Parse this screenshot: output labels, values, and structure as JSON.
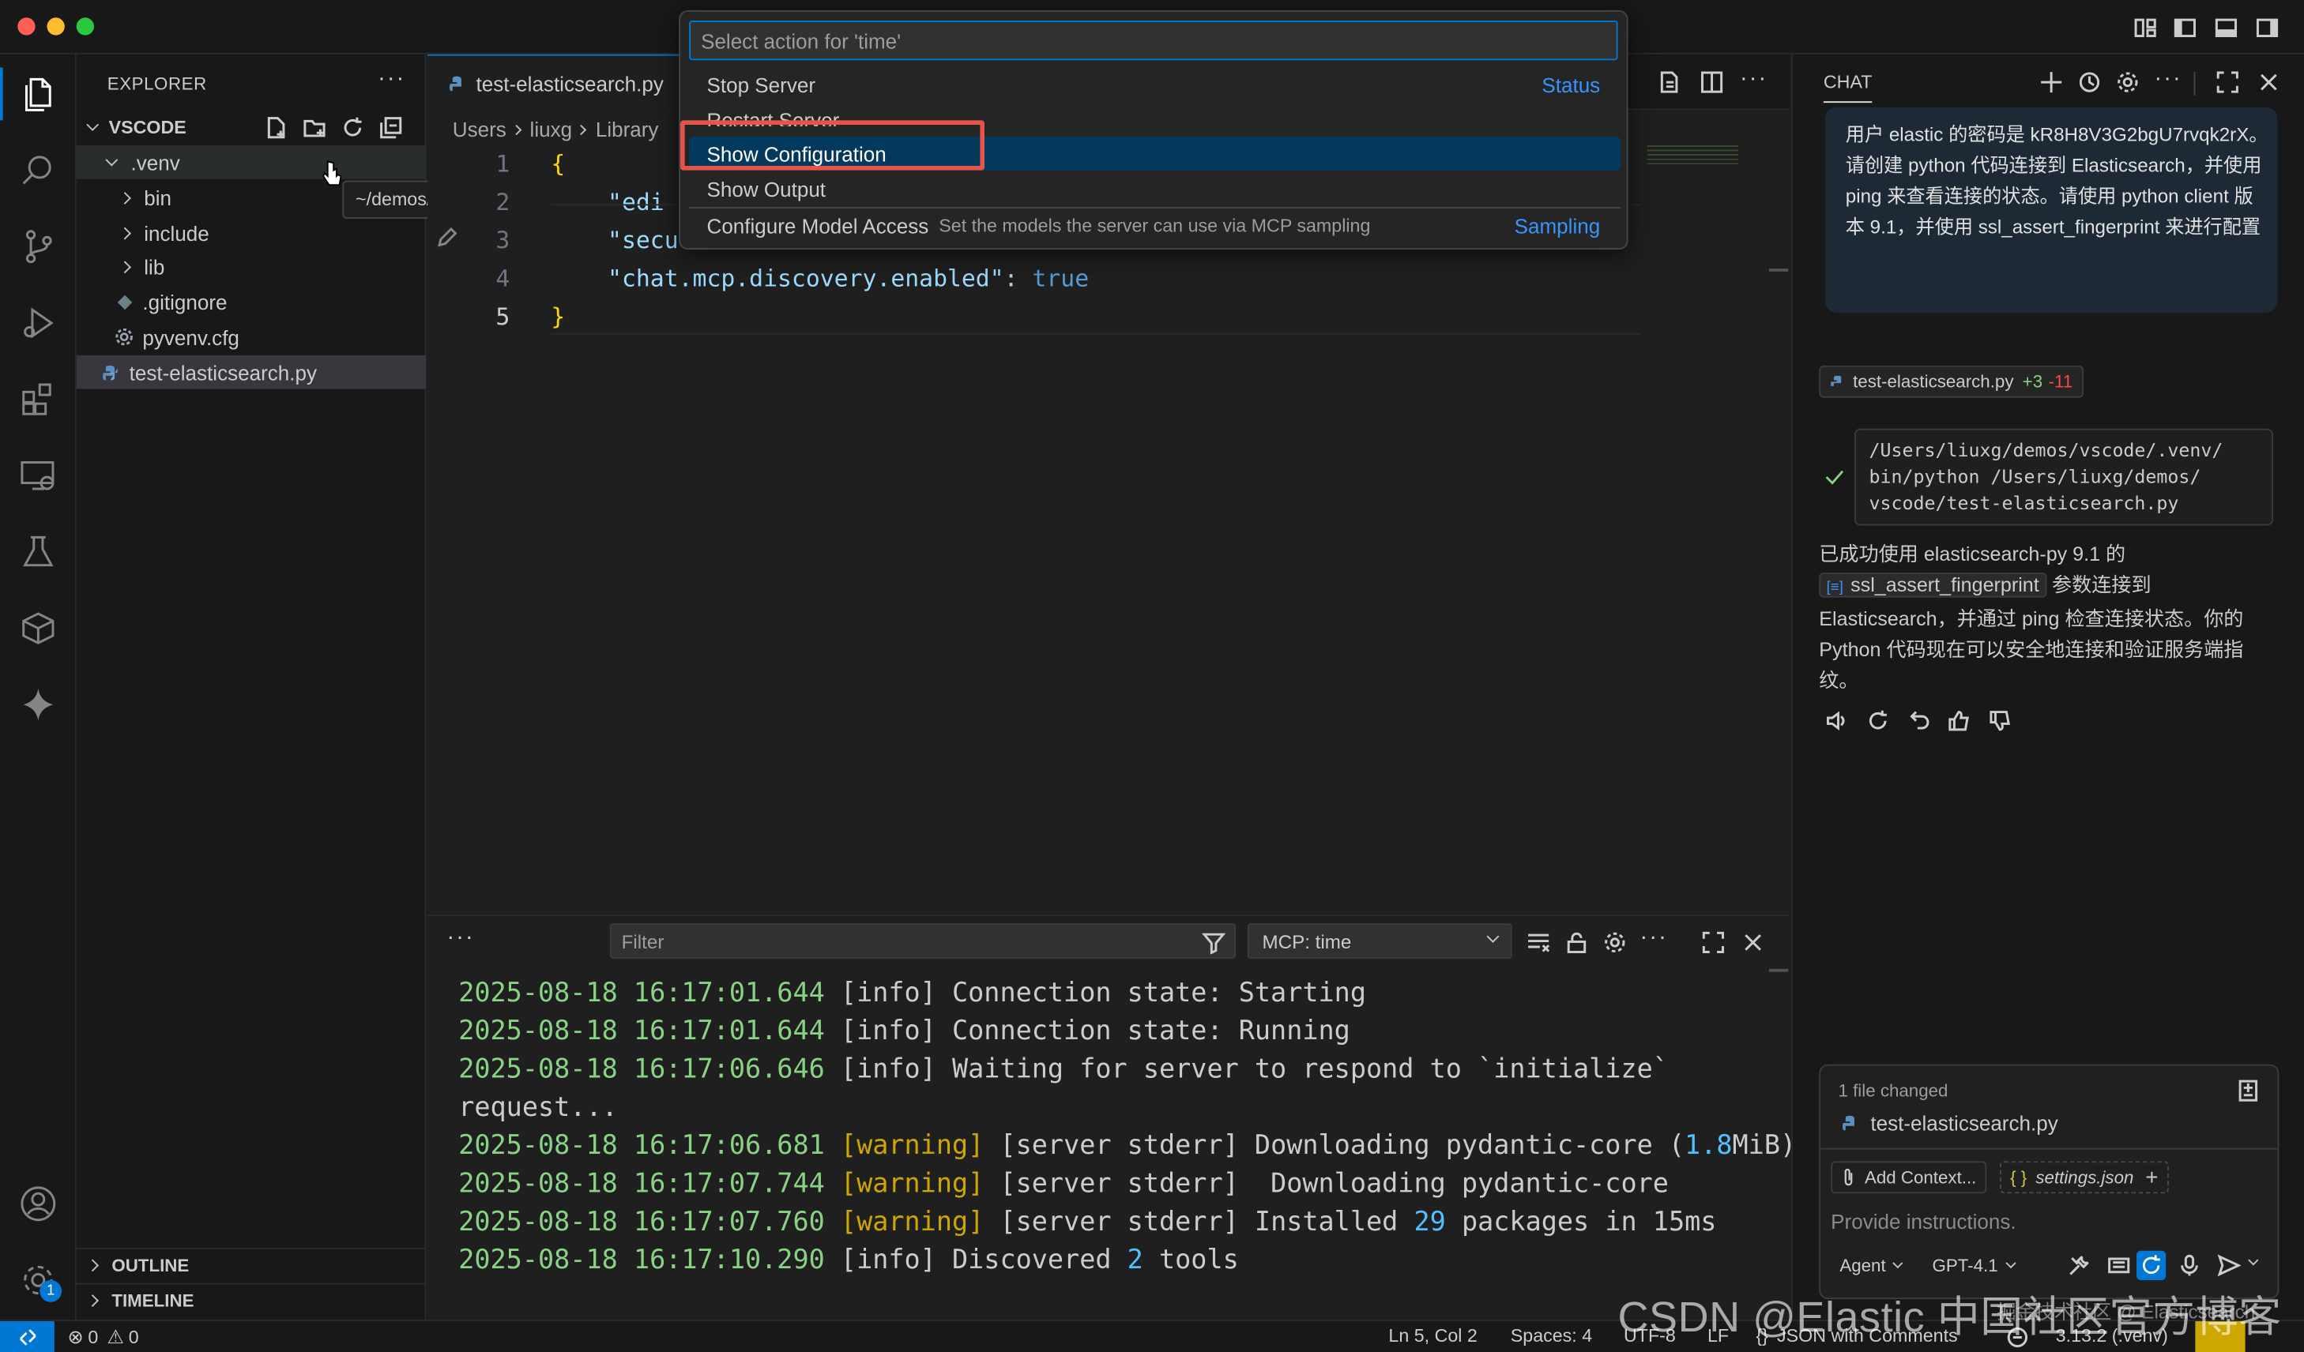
{
  "colors": {
    "accent": "#0078d4",
    "selection": "#04395e",
    "highlight_box": "#e5534b",
    "string": "#ce9178",
    "key": "#9cdcfe",
    "bool": "#569cd6",
    "brace": "#ffd700",
    "timestamp": "#89d185",
    "warning": "#cca700",
    "number": "#4fc1ff"
  },
  "explorer": {
    "title": "EXPLORER",
    "root": "VSCODE",
    "items": [
      {
        "label": ".venv",
        "kind": "folder-open"
      },
      {
        "label": "bin",
        "kind": "folder"
      },
      {
        "label": "include",
        "kind": "folder"
      },
      {
        "label": "lib",
        "kind": "folder"
      },
      {
        "label": ".gitignore",
        "kind": "git-file"
      },
      {
        "label": "pyvenv.cfg",
        "kind": "gear-file"
      },
      {
        "label": "test-elasticsearch.py",
        "kind": "python-file"
      }
    ],
    "tooltip": "~/demos/vscode/.venv",
    "outline": "OUTLINE",
    "timeline": "TIMELINE",
    "accounts_badge": "1"
  },
  "editor": {
    "tab_label": "test-elasticsearch.py",
    "breadcrumb": [
      "Users",
      "liuxg",
      "Library"
    ],
    "lines": [
      {
        "n": "1",
        "parts": [
          {
            "t": "{",
            "c": "brace"
          }
        ]
      },
      {
        "n": "2",
        "parts": [
          {
            "t": "    \"edi",
            "c": "key"
          }
        ]
      },
      {
        "n": "3",
        "parts": [
          {
            "t": "    \"secu",
            "c": "key"
          }
        ]
      },
      {
        "n": "4",
        "parts": [
          {
            "t": "    \"chat.mcp.discovery.enabled\"",
            "c": "key"
          },
          {
            "t": ": ",
            "c": "plain"
          },
          {
            "t": "true",
            "c": "bool"
          }
        ]
      },
      {
        "n": "5",
        "parts": [
          {
            "t": "}",
            "c": "brace"
          }
        ]
      }
    ]
  },
  "quick_pick": {
    "placeholder": "Select action for 'time'",
    "items": [
      {
        "label": "Stop Server",
        "desc": "",
        "right": "Status"
      },
      {
        "label": "Restart Server",
        "desc": "",
        "right": ""
      },
      {
        "label": "Show Configuration",
        "desc": "",
        "right": ""
      },
      {
        "label": "Show Output",
        "desc": "",
        "right": ""
      },
      {
        "label": "Configure Model Access",
        "desc": "Set the models the server can use via MCP sampling",
        "right": "Sampling"
      }
    ]
  },
  "panel": {
    "filter_placeholder": "Filter",
    "channel": "MCP: time",
    "logs": [
      [
        {
          "t": "2025-08-18 16:17:01.644",
          "c": "ts"
        },
        {
          "t": " [info] Connection state: Starting",
          "c": "info"
        }
      ],
      [
        {
          "t": "2025-08-18 16:17:01.644",
          "c": "ts"
        },
        {
          "t": " [info] Connection state: Running",
          "c": "info"
        }
      ],
      [
        {
          "t": "2025-08-18 16:17:06.646",
          "c": "ts"
        },
        {
          "t": " [info] Waiting for server to respond to `initialize`",
          "c": "info"
        }
      ],
      [
        {
          "t": "request...",
          "c": "info"
        }
      ],
      [
        {
          "t": "2025-08-18 16:17:06.681",
          "c": "ts"
        },
        {
          "t": " [warning]",
          "c": "warn"
        },
        {
          "t": " [server stderr] Downloading pydantic-core (",
          "c": "info"
        },
        {
          "t": "1.8",
          "c": "num"
        },
        {
          "t": "MiB)",
          "c": "info"
        }
      ],
      [
        {
          "t": "2025-08-18 16:17:07.744",
          "c": "ts"
        },
        {
          "t": " [warning]",
          "c": "warn"
        },
        {
          "t": " [server stderr]  Downloading pydantic-core",
          "c": "info"
        }
      ],
      [
        {
          "t": "2025-08-18 16:17:07.760",
          "c": "ts"
        },
        {
          "t": " [warning]",
          "c": "warn"
        },
        {
          "t": " [server stderr] Installed ",
          "c": "info"
        },
        {
          "t": "29",
          "c": "num"
        },
        {
          "t": " packages in 15ms",
          "c": "info"
        }
      ],
      [
        {
          "t": "2025-08-18 16:17:10.290",
          "c": "ts"
        },
        {
          "t": " [info] Discovered ",
          "c": "info"
        },
        {
          "t": "2",
          "c": "num"
        },
        {
          "t": " tools",
          "c": "info"
        }
      ]
    ]
  },
  "chat": {
    "title": "CHAT",
    "user_message": "用户 elastic 的密码是 kR8H8V3G2bgU7rvqk2rX。请创建 python 代码连接到 Elasticsearch，并使用 ping 来查看连接的状态。请使用 python client 版本 9.1，并使用 ssl_assert_fingerprint 来进行配置",
    "file_chip": "test-elasticsearch.py",
    "added": "+3",
    "removed": "-11",
    "command": "/Users/liuxg/demos/vscode/.venv/\nbin/python /Users/liuxg/demos/\nvscode/test-elasticsearch.py",
    "response_pre": "已成功使用 elasticsearch-py 9.1 的",
    "response_code": "ssl_assert_fingerprint",
    "response_mid": " 参数连接到",
    "response_post": "Elasticsearch，并通过 ping 检查连接状态。你的 Python 代码现在可以安全地连接和验证服务端指纹。",
    "changes_label": "1 file changed",
    "changed_file": "test-elasticsearch.py",
    "add_context": "Add Context...",
    "context_file": "settings.json",
    "input_placeholder": "Provide instructions.",
    "mode": "Agent",
    "model": "GPT-4.1"
  },
  "status": {
    "errors": "0",
    "warnings": "0",
    "position": "Ln 5, Col 2",
    "spaces": "Spaces: 4",
    "encoding": "UTF-8",
    "eol": "LF",
    "language": "JSON with Comments",
    "python": "3.13.2 (.venv)"
  },
  "watermark": "CSDN @Elastic 中国社区官方博客",
  "watermark_small": "掘金技术社区 @ Elasticsearch"
}
